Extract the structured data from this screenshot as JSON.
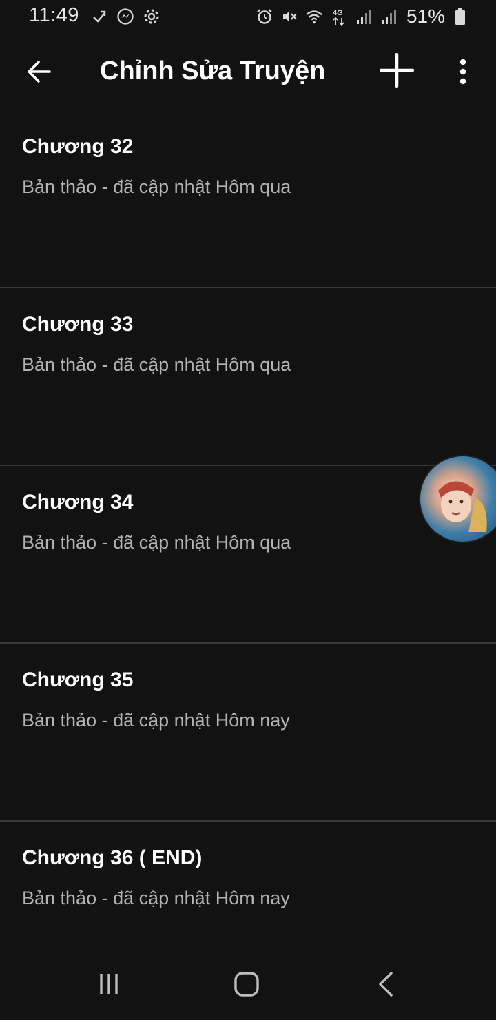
{
  "status_bar": {
    "time": "11:49",
    "battery_percent": "51%",
    "left_icons": [
      "sync-icon",
      "messenger-icon",
      "settings-gear-icon"
    ],
    "right_icons": [
      "alarm-icon",
      "mute-icon",
      "wifi-icon",
      "4g-icon",
      "signal-icon",
      "signal-icon",
      "battery-icon"
    ]
  },
  "app_bar": {
    "title": "Chỉnh Sửa Truyện",
    "back_icon": "arrow-left-icon",
    "add_icon": "plus-icon",
    "more_icon": "more-vertical-icon"
  },
  "chapters": [
    {
      "title": "Chương 32",
      "subtitle": "Bản thảo - đã cập nhật Hôm qua"
    },
    {
      "title": "Chương 33",
      "subtitle": "Bản thảo - đã cập nhật Hôm qua"
    },
    {
      "title": "Chương 34",
      "subtitle": "Bản thảo - đã cập nhật Hôm qua"
    },
    {
      "title": "Chương 35",
      "subtitle": "Bản thảo - đã cập nhật Hôm nay"
    },
    {
      "title": "Chương 36 ( END)",
      "subtitle": "Bản thảo - đã cập nhật Hôm nay"
    }
  ],
  "nav_bar": {
    "recents_icon": "recents-icon",
    "home_icon": "home-icon",
    "back_icon": "chevron-left-icon"
  },
  "colors": {
    "background": "#121212",
    "title_text": "#ffffff",
    "subtitle_text": "#b3b3b3",
    "divider": "#3a3a3a"
  }
}
